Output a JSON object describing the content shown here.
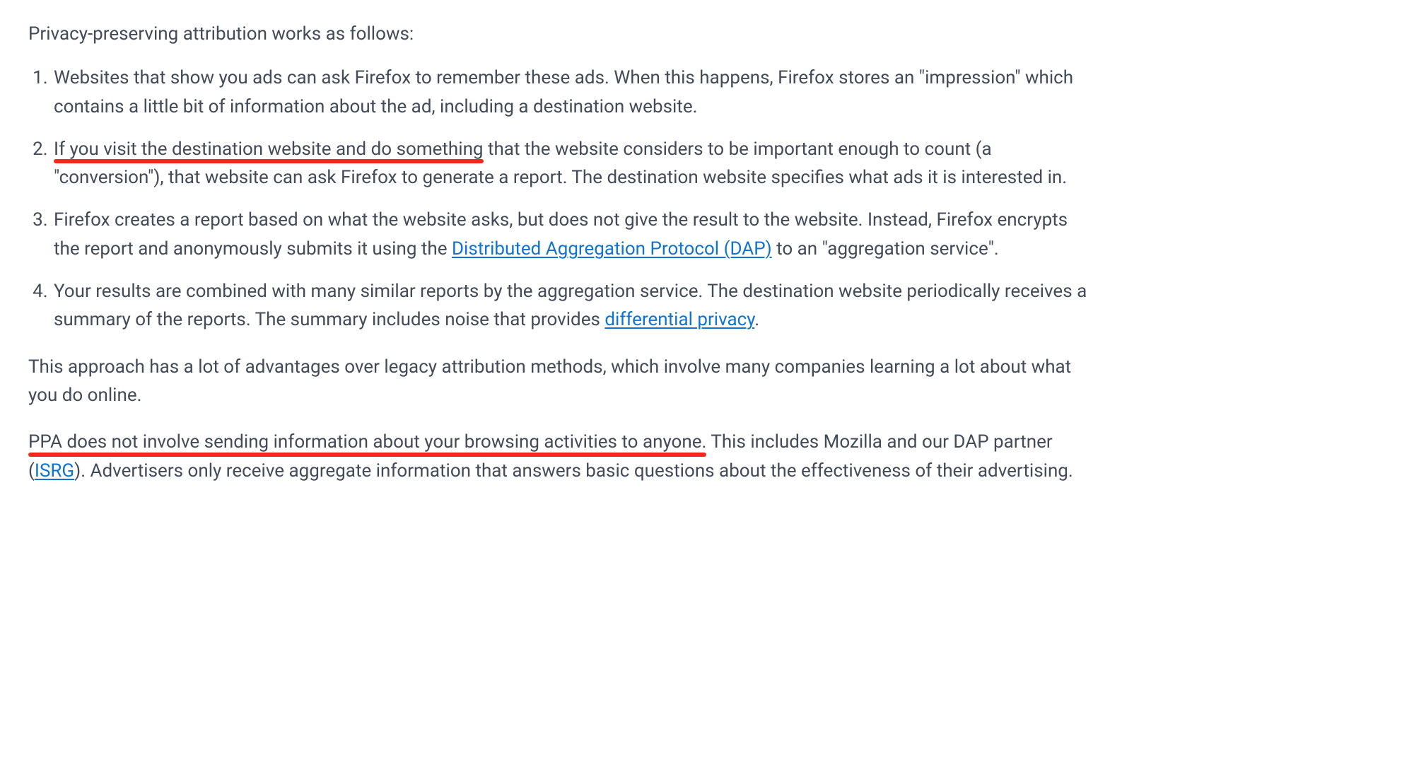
{
  "intro": "Privacy-preserving attribution works as follows:",
  "items": [
    {
      "text": "Websites that show you ads can ask Firefox to remember these ads. When this happens, Firefox stores an \"impression\" which contains a little bit of information about the ad, including a destination website."
    },
    {
      "u1": "If you visit the destination website and do something",
      "rest": " that the website considers to be important enough to count (a \"conversion\"), that website can ask Firefox to generate a report. The destination website specifies what ads it is interested in."
    },
    {
      "pre": "Firefox creates a report based on what the website asks, but does not give the result to the website. Instead, ",
      "u1": "Firefox encrypts the report and anonymously submits",
      "mid": " it using the ",
      "link": "Distributed Aggregation Protocol (DAP)",
      "post": " to an \"aggregation service\"."
    },
    {
      "pre": "Your results are combined with many similar reports by the aggregation service. The destination website periodically receives a summary of the reports. The summary includes noise that provides ",
      "link": "differential privacy",
      "post": "."
    }
  ],
  "para_advantages": "This approach has a lot of advantages over legacy attribution methods, which involve many companies learning a lot about what you do online.",
  "closing": {
    "u1": "PPA does not involve sending information about your browsing activities to anyone.",
    "mid": " This includes Mozilla and our DAP partner (",
    "link": "ISRG",
    "post": "). Advertisers only receive aggregate information that answers basic questions about the effectiveness of their advertising."
  }
}
